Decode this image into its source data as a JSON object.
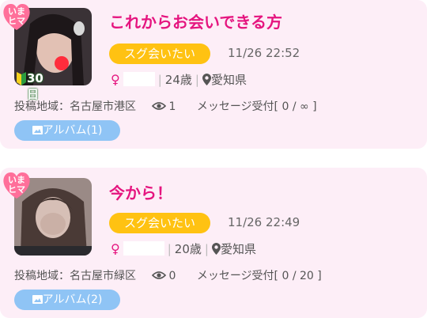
{
  "posts": [
    {
      "badge": [
        "いま",
        "ヒマ"
      ],
      "newbie_label": "30日",
      "title": "これからお会いできる方",
      "tag": "スグ会いたい",
      "datetime": "11/26 22:52",
      "gender_symbol": "♀",
      "age": "24歳",
      "location": "愛知県",
      "region_label": "投稿地域：名古屋市港区",
      "views": "1",
      "message_label": "メッセージ受付[ 0 / ∞ ]",
      "album_label": "アルバム(1)"
    },
    {
      "badge": [
        "いま",
        "ヒマ"
      ],
      "title": "今から！",
      "tag": "スグ会いたい",
      "datetime": "11/26 22:49",
      "gender_symbol": "♀",
      "age": "20歳",
      "location": "愛知県",
      "region_label": "投稿地域：名古屋市緑区",
      "views": "0",
      "message_label": "メッセージ受付[ 0 / 20 ]",
      "album_label": "アルバム(2)"
    }
  ],
  "colors": {
    "card_bg": "#fdeef7",
    "title": "#e5157f",
    "tag_bg": "#ffc212",
    "album_bg": "#8fc4f5",
    "badge_bg": "#ff6f9a"
  }
}
